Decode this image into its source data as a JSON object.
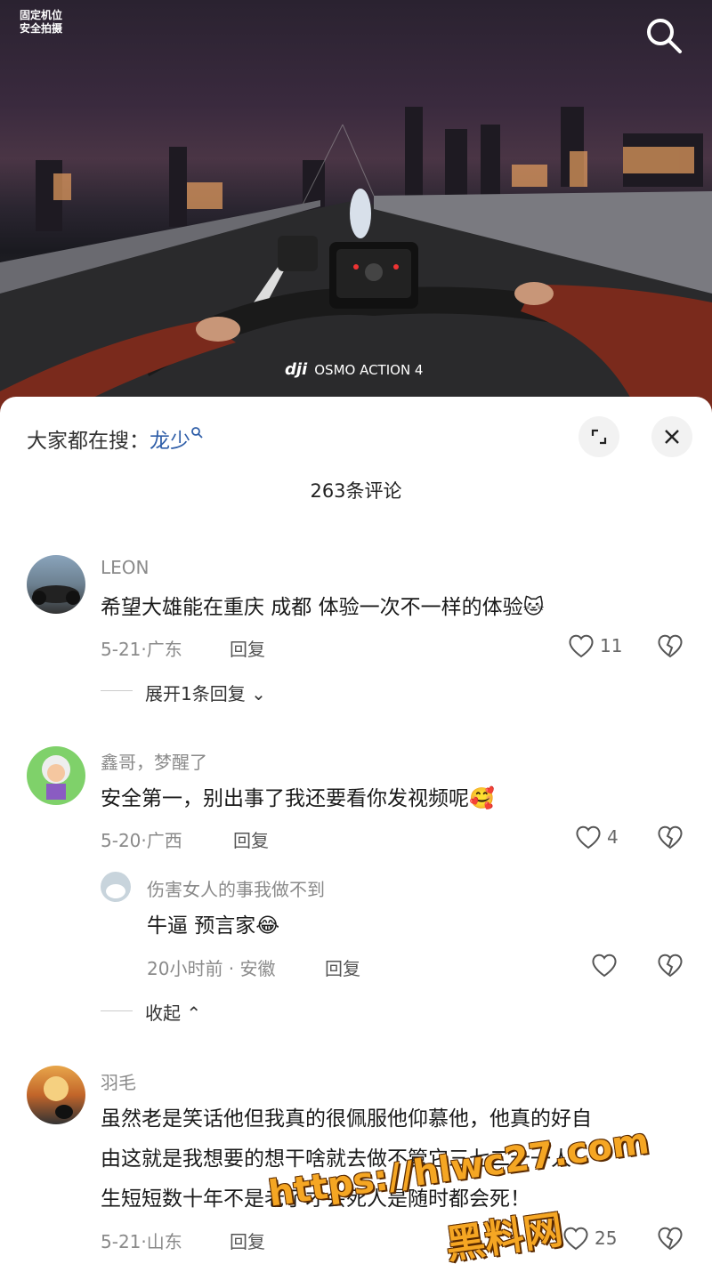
{
  "video": {
    "corner_text_1": "固定机位",
    "corner_text_2": "安全拍摄",
    "brand": "OSMO ACTION 4"
  },
  "sheet": {
    "suggest_prefix": "大家都在搜：",
    "suggest_keyword": "龙少",
    "comment_count": "263条评论"
  },
  "comments": [
    {
      "user": "LEON",
      "text": "希望大雄能在重庆  成都 体验一次不一样的体验🐱",
      "meta": "5-21·广东",
      "reply": "回复",
      "likes": "11",
      "expand": "展开1条回复"
    },
    {
      "user": "鑫哥，梦醒了",
      "text": "安全第一，别出事了我还要看你发视频呢🥰",
      "meta": "5-20·广西",
      "reply": "回复",
      "likes": "4",
      "sub": {
        "user": "伤害女人的事我做不到",
        "text": "牛逼 预言家😂",
        "meta": "20小时前 · 安徽",
        "reply": "回复"
      },
      "collapse": "收起"
    },
    {
      "user": "羽毛",
      "line1": "虽然老是笑话他但我真的很佩服他仰慕他，他真的好自",
      "line2": "由这就是我想要的想干啥就去做不管它三七二十一人",
      "line3": "生短短数十年不是老了才会死人是随时都会死！",
      "meta": "5-21·山东",
      "reply": "回复",
      "likes": "25"
    }
  ],
  "overlay_watermark": {
    "url": "https://hlwc27.com",
    "name": "黑料网"
  }
}
